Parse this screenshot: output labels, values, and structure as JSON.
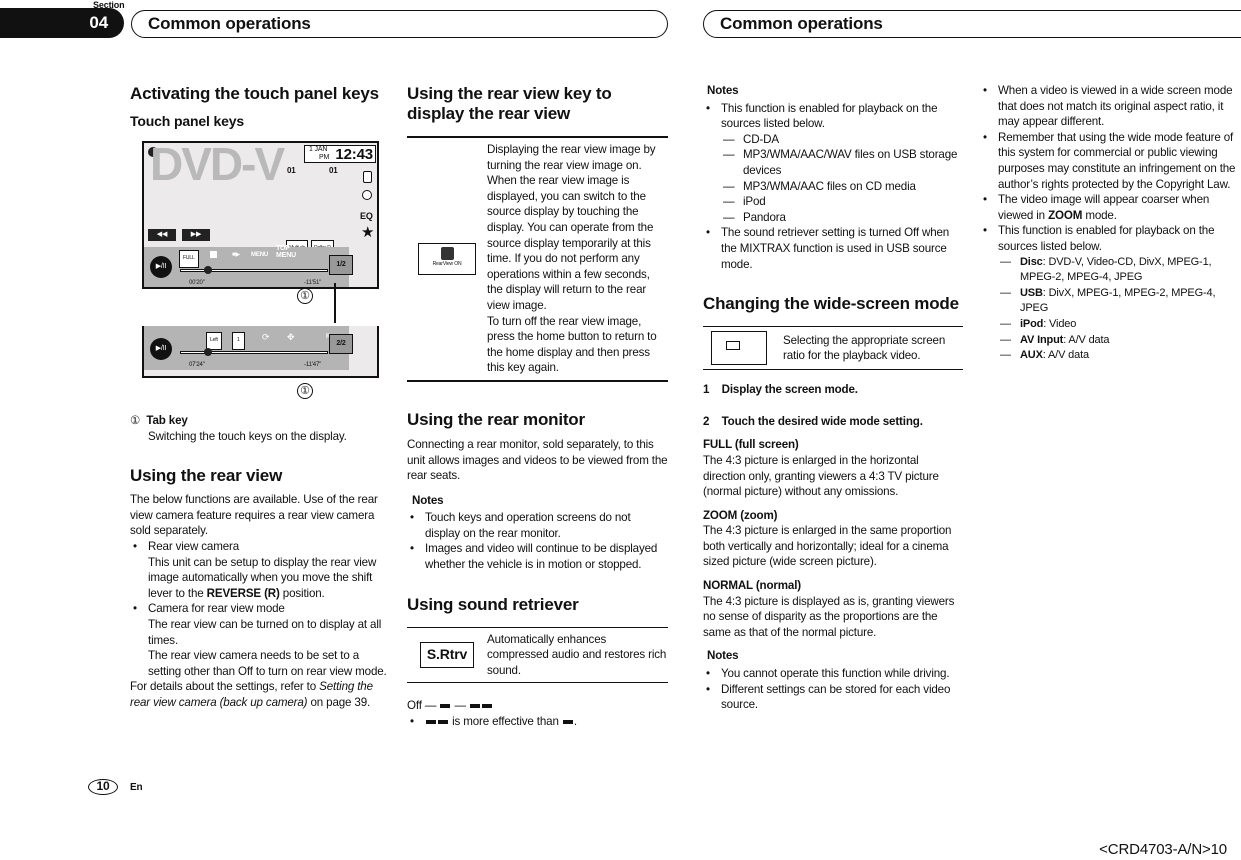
{
  "header": {
    "section_label": "Section",
    "section_number": "04",
    "title_left": "Common operations",
    "title_right": "Common operations"
  },
  "col1": {
    "h1": "Activating the touch panel keys",
    "h2": "Touch panel keys",
    "figure": {
      "source": "DVD-V",
      "date": "1 JAN",
      "ampm": "PM",
      "clock": "12:43",
      "track1": "01",
      "track2": "01",
      "eq": "EQ",
      "menu": "MENU",
      "top_menu": "TOP MENU",
      "multi_ch": "Multi ch",
      "dolby": "Dolby D",
      "time1": "00'20\"",
      "remain1": "-11'51\"",
      "time2": "07'24\"",
      "remain2": "-11'47\"",
      "tab1": "1/2",
      "tab2": "2/2",
      "return": "Return",
      "callout": "①",
      "full": "FULL",
      "left": "Left",
      "one": "1"
    },
    "tab_key_num": "①",
    "tab_key_title": "Tab key",
    "tab_key_desc": "Switching the touch keys on the display.",
    "h_rear": "Using the rear view",
    "rear_intro": "The below functions are available. Use of the rear view camera feature requires a rear view camera sold separately.",
    "b1_title": "Rear view camera",
    "b1_a": "This unit can be setup to display the rear view image automatically when you move the shift lever to the ",
    "b1_bold": "REVERSE (R)",
    "b1_b": " position.",
    "b2_title": "Camera for rear view mode",
    "b2_a": "The rear view can be turned on to display at all times.",
    "b2_b": "The rear view camera needs to be set to a setting other than Off to turn on rear view mode.",
    "details_a": "For details about the settings, refer to ",
    "details_i": "Setting the rear view camera (back up camera)",
    "details_b": " on page 39."
  },
  "col2": {
    "h_key": "Using the rear view key to display the rear view",
    "rv_icon_label": "RearView ON",
    "rv_text1": "Displaying the rear view image by turning the rear view image on. When the rear view image is displayed, you can switch to the source display by touching the display. You can operate from the source display temporarily at this time. If you do not perform any operations within a few seconds, the display will return to the rear view image.",
    "rv_text2": "To turn off the rear view image, press the home button to return to the home display and then press this key again.",
    "h_monitor": "Using the rear monitor",
    "monitor_text": "Connecting a rear monitor, sold separately, to this unit allows images and videos to be viewed from the rear seats.",
    "notes": "Notes",
    "notes_items": [
      "Touch keys and operation screens do not display on the rear monitor.",
      "Images and video will continue to be displayed whether the vehicle is in motion or stopped."
    ],
    "h_retriever": "Using sound retriever",
    "srtrv_icon": "S.Rtrv",
    "srtrv_text": "Automatically enhances compressed audio and restores rich sound.",
    "off": "Off —",
    "sep": "—",
    "effective": "is more effective than"
  },
  "col3": {
    "notes": "Notes",
    "n1": "This function is enabled for playback on the sources listed below.",
    "n1_list": [
      "CD-DA",
      "MP3/WMA/AAC/WAV files on USB storage devices",
      "MP3/WMA/AAC files on CD media",
      "iPod",
      "Pandora"
    ],
    "n2": "The sound retriever setting is turned Off when the MIXTRAX function is used in USB source mode.",
    "h_wide": "Changing the wide-screen mode",
    "wide_text": "Selecting the appropriate screen ratio for the playback video.",
    "step1_num": "1",
    "step1": "Display the screen mode.",
    "step2_num": "2",
    "step2": "Touch the desired wide mode setting.",
    "modes": [
      {
        "title": "FULL (full screen)",
        "text": "The 4:3 picture is enlarged in the horizontal direction only, granting viewers a 4:3 TV picture (normal picture) without any omissions."
      },
      {
        "title": "ZOOM (zoom)",
        "text": "The 4:3 picture is enlarged in the same proportion both vertically and horizontally; ideal for a cinema sized picture (wide screen picture)."
      },
      {
        "title": "NORMAL (normal)",
        "text": "The 4:3 picture is displayed as is, granting viewers no sense of disparity as the proportions are the same as that of the normal picture."
      }
    ],
    "notes2": "Notes",
    "notes2_items": [
      "You cannot operate this function while driving.",
      "Different settings can be stored for each video source."
    ]
  },
  "col4": {
    "b1": "When a video is viewed in a wide screen mode that does not match its original aspect ratio, it may appear different.",
    "b2": "Remember that using the wide mode feature of this system for commercial or public viewing purposes may constitute an infringement on the author’s rights protected by the Copyright Law.",
    "b3_a": "The video image will appear coarser when viewed in ",
    "b3_bold": "ZOOM",
    "b3_b": " mode.",
    "b4": "This function is enabled for playback on the sources listed below.",
    "sources": [
      {
        "name": "Disc",
        "value": ": DVD-V, Video-CD, DivX, MPEG-1, MPEG-2, MPEG-4, JPEG"
      },
      {
        "name": "USB",
        "value": ": DivX, MPEG-1, MPEG-2, MPEG-4, JPEG"
      },
      {
        "name": "iPod",
        "value": ": Video"
      },
      {
        "name": "AV Input",
        "value": ": A/V data"
      },
      {
        "name": "AUX",
        "value": ": A/V data"
      }
    ]
  },
  "footer": {
    "page": "10",
    "lang": "En",
    "code": "<CRD4703-A/N>10"
  }
}
